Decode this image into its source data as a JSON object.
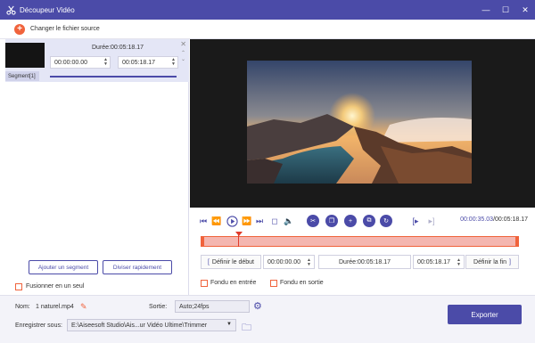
{
  "window": {
    "title": "Découpeur Vidéo",
    "minimize_icon": "minimize-icon",
    "maximize_icon": "maximize-icon",
    "close_icon": "close-icon",
    "accent_color": "#4b4ba8"
  },
  "source": {
    "change_label": "Changer le fichier source"
  },
  "segment": {
    "duration_label": "Durée:00:05:18.17",
    "start": "00:00:00.00",
    "end": "00:05:18.17",
    "label": "Segment[1]"
  },
  "left_actions": {
    "add_segment": "Ajouter un segment",
    "fast_split": "Diviser rapidement",
    "merge_label": "Fusionner en un seul"
  },
  "playback": {
    "current_time": "00:00:35.03",
    "separator": "/",
    "total_time": "00:05:18.17"
  },
  "define": {
    "start_button": "Définir le début",
    "start_time": "00:00:00.00",
    "duration": "Durée:00:05:18.17",
    "end_time": "00:05:18.17",
    "end_button": "Définir la fin"
  },
  "fades": {
    "fade_in": "Fondu en entrée",
    "fade_out": "Fondu en sortie"
  },
  "output": {
    "name_label": "Nom:",
    "name_value": "1 naturel.mp4",
    "output_label": "Sortie:",
    "output_value": "Auto;24fps",
    "save_label": "Enregistrer sous:",
    "save_path": "E:\\Aiseesoft Studio\\Ais...ur Vidéo Ultime\\Trimmer",
    "export_button": "Exporter"
  }
}
